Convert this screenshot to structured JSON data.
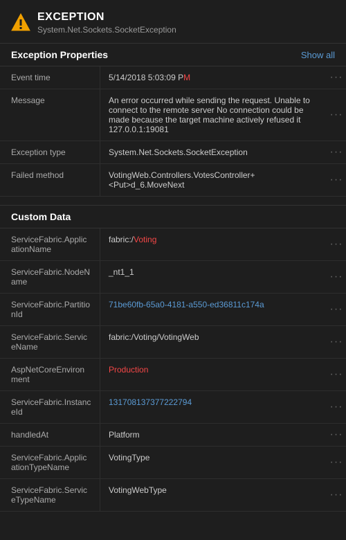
{
  "header": {
    "icon_alt": "exception-warning-icon",
    "label": "EXCEPTION",
    "exception_type": "System.Net.Sockets.SocketException"
  },
  "exception_properties": {
    "section_title": "Exception Properties",
    "show_all": "Show all",
    "rows": [
      {
        "key": "Event time",
        "value_plain": "5/14/2018 5:03:09 PM",
        "value_highlight": "",
        "highlight_part": "M",
        "has_highlight": true
      },
      {
        "key": "Message",
        "value_plain": "An error occurred while sending the request. Unable to connect to the remote server No connection could be made because the target machine actively refused it 127.0.0.1:19081",
        "has_highlight": false
      },
      {
        "key": "Exception type",
        "value_plain": "System.Net.Sockets.SocketException",
        "has_highlight": false
      },
      {
        "key": "Failed method",
        "value_plain": "VotingWeb.Controllers.VotesController+<Put>d_6.MoveNext",
        "has_highlight": false
      }
    ]
  },
  "custom_data": {
    "section_title": "Custom Data",
    "rows": [
      {
        "key": "ServiceFabric.ApplicationName",
        "value_plain": "fabric:/Voting",
        "highlight_part": "Voting",
        "has_highlight": true,
        "link": false
      },
      {
        "key": "ServiceFabric.NodeName",
        "value_plain": "_nt1_1",
        "has_highlight": false,
        "link": false
      },
      {
        "key": "ServiceFabric.PartitionId",
        "value_plain": "71be60fb-65a0-4181-a550-ed36811c174a",
        "has_highlight": false,
        "link": true
      },
      {
        "key": "ServiceFabric.ServiceName",
        "value_plain": "fabric:/Voting/VotingWeb",
        "has_highlight": false,
        "link": false
      },
      {
        "key": "AspNetCoreEnvironment",
        "value_plain": "Production",
        "highlight_part": "Production",
        "has_highlight": true,
        "link": false
      },
      {
        "key": "ServiceFabric.InstanceId",
        "value_plain": "131708137377222794",
        "has_highlight": false,
        "link": true
      },
      {
        "key": "handledAt",
        "value_plain": "Platform",
        "has_highlight": false,
        "link": false
      },
      {
        "key": "ServiceFabric.ApplicationTypeName",
        "value_plain": "VotingType",
        "has_highlight": false,
        "link": false
      },
      {
        "key": "ServiceFabric.ServiceTypeName",
        "value_plain": "VotingWebType",
        "has_highlight": false,
        "link": false
      }
    ]
  },
  "menu_dots": "···"
}
